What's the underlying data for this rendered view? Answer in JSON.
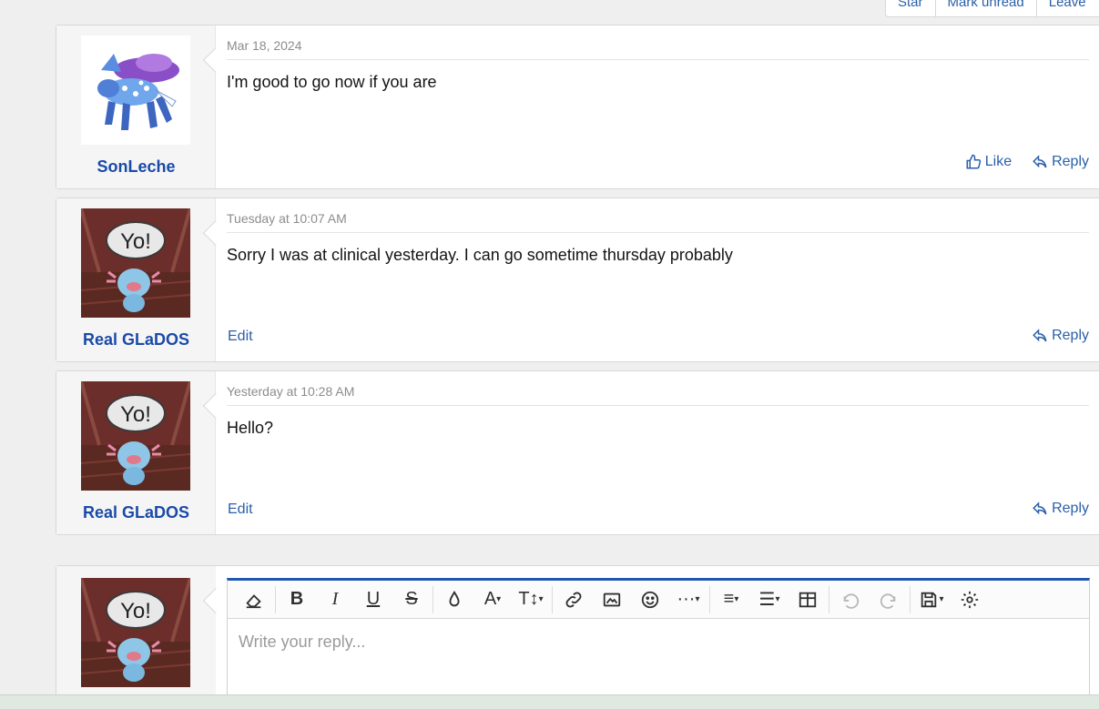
{
  "top_actions": [
    "Star",
    "Mark unread",
    "Leave"
  ],
  "messages": [
    {
      "username": "SonLeche",
      "avatar": "suicune-sprite",
      "date": "Mar 18, 2024",
      "text": "I'm good to go now if you are",
      "edit": "",
      "like": "Like",
      "reply": "Reply"
    },
    {
      "username": "Real GLaDOS",
      "avatar": "wooper-yo",
      "date": "Tuesday at 10:07 AM",
      "text": "Sorry I was at clinical yesterday. I can go sometime thursday probably",
      "edit": "Edit",
      "like": "",
      "reply": "Reply"
    },
    {
      "username": "Real GLaDOS",
      "avatar": "wooper-yo",
      "date": "Yesterday at 10:28 AM",
      "text": "Hello?",
      "edit": "Edit",
      "like": "",
      "reply": "Reply"
    }
  ],
  "avatar_bubble_text": "Yo!",
  "reply_editor": {
    "placeholder": "Write your reply...",
    "toolbar": [
      "eraser-icon",
      "bold-icon",
      "italic-icon",
      "underline-icon",
      "strikethrough-icon",
      "color-icon",
      "font-family-icon",
      "font-size-icon",
      "link-icon",
      "image-icon",
      "smiley-icon",
      "more-icon",
      "align-icon",
      "list-icon",
      "table-icon",
      "undo-icon",
      "redo-icon",
      "drafts-icon",
      "settings-icon"
    ]
  },
  "colors": {
    "link": "#2a5fa8",
    "username": "#1a4aa8",
    "editor_accent": "#1f58b0"
  }
}
